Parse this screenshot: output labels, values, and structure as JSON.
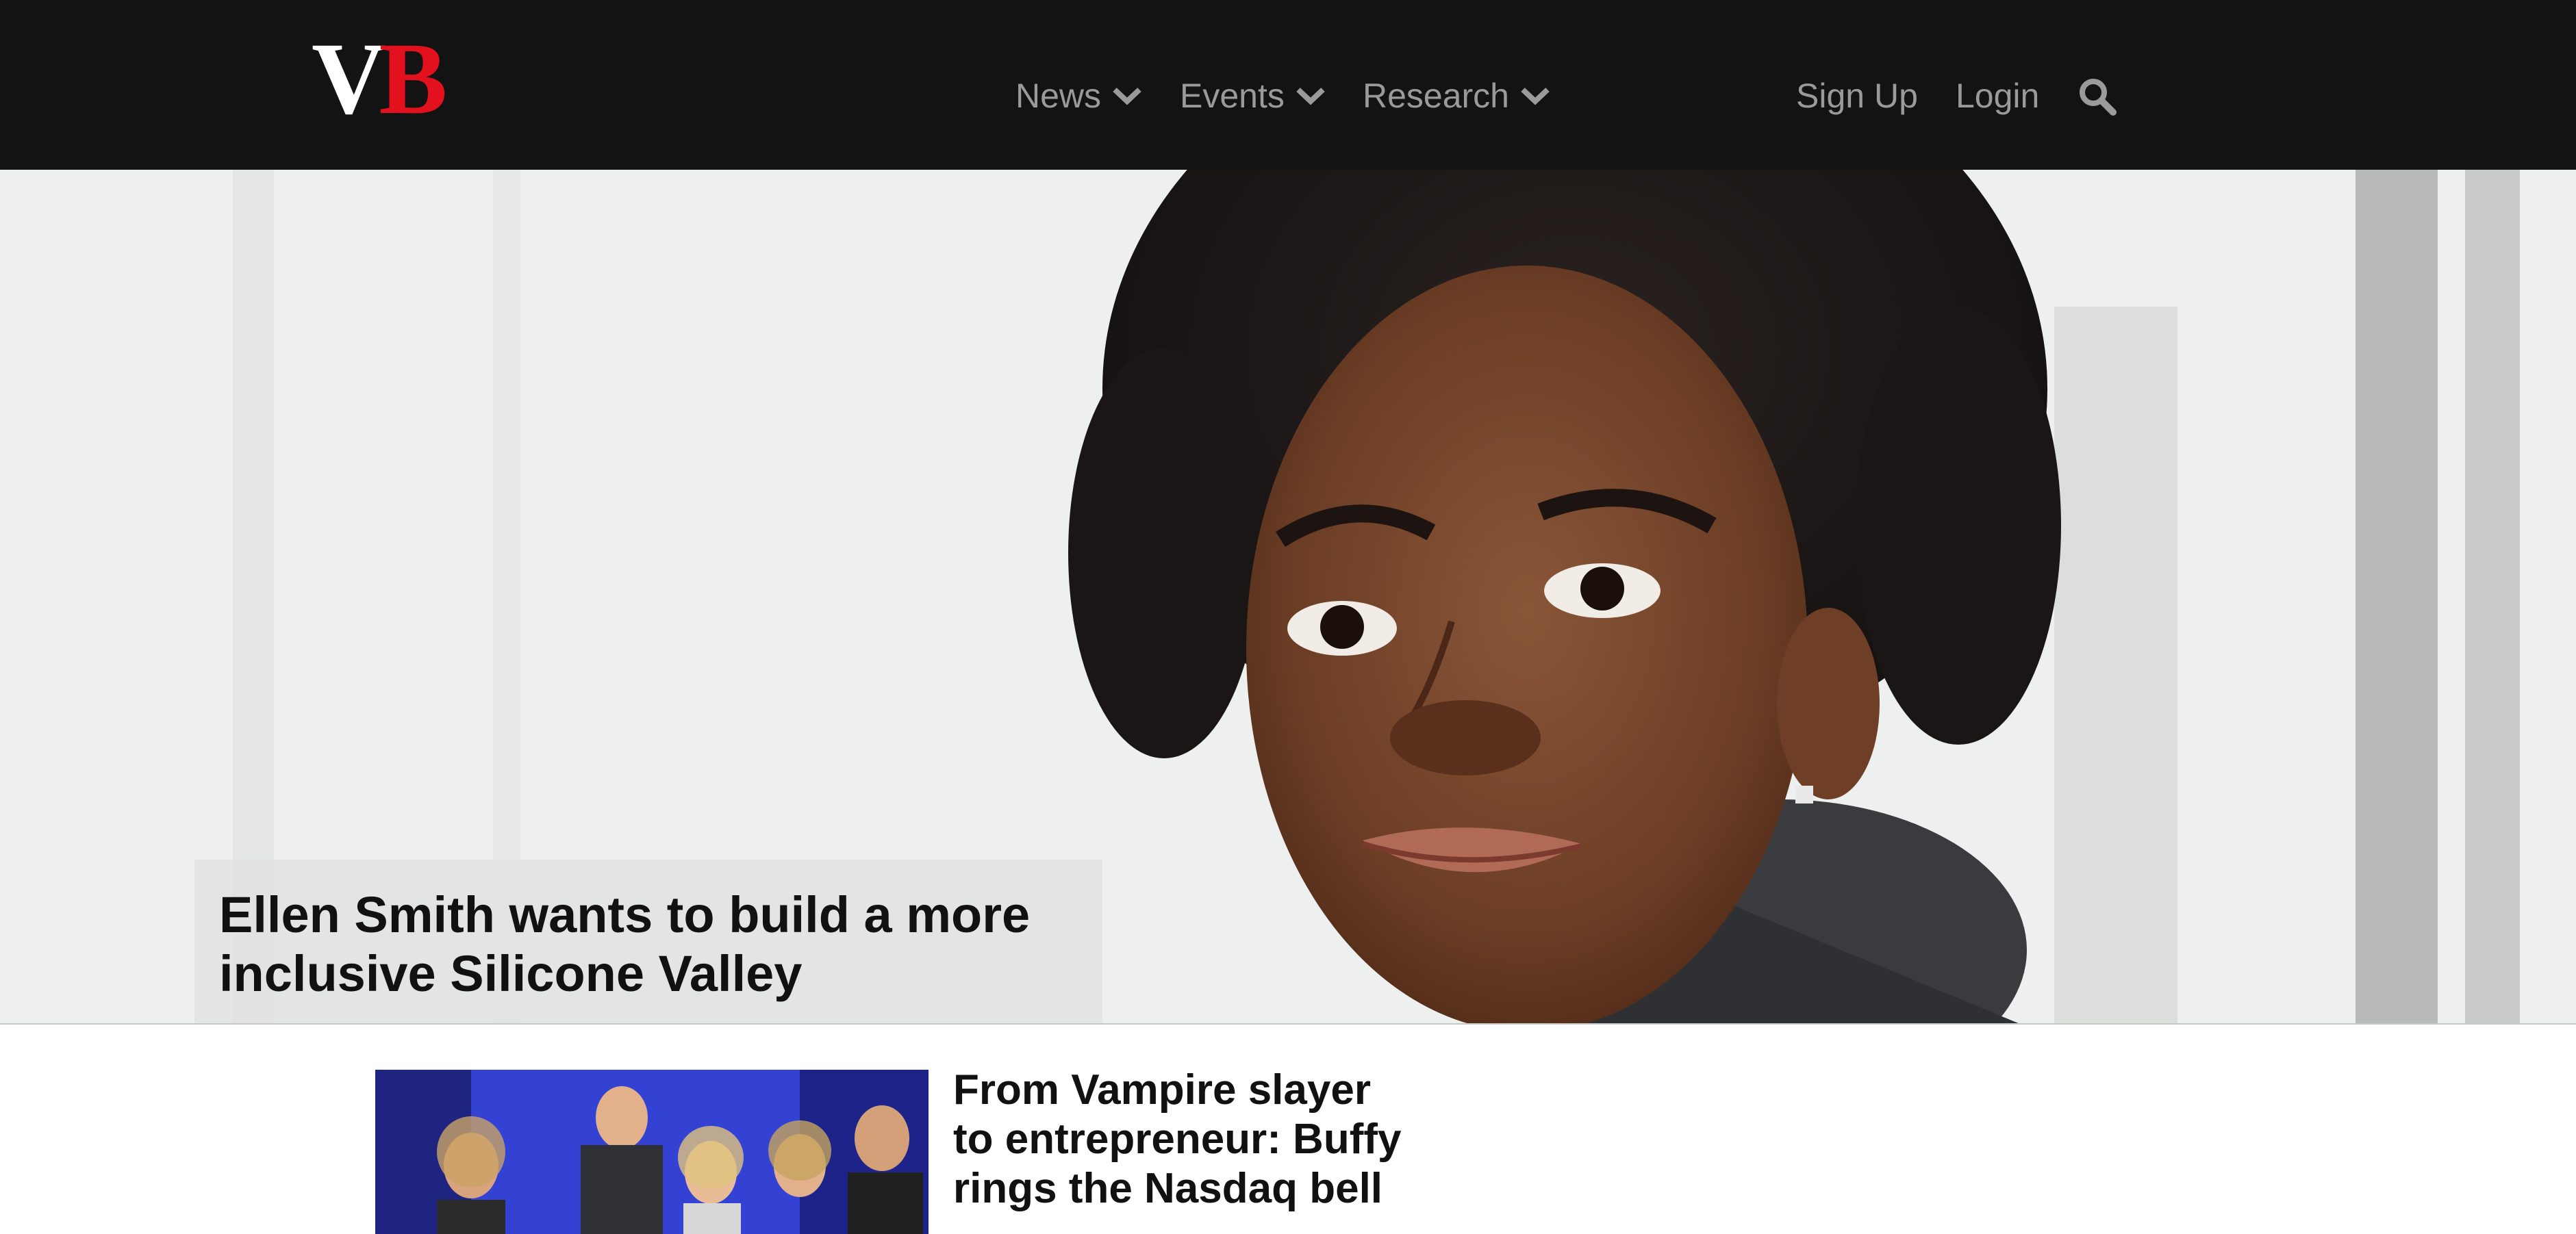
{
  "brand": {
    "logo_v": "V",
    "logo_b": "B",
    "accent": "#e3101d",
    "topbar_bg": "#131313"
  },
  "nav": {
    "items": [
      {
        "label": "News",
        "icon": "chevron-down-icon"
      },
      {
        "label": "Events",
        "icon": "chevron-down-icon"
      },
      {
        "label": "Research",
        "icon": "chevron-down-icon"
      }
    ],
    "signup": "Sign Up",
    "login": "Login",
    "search_icon": "search-icon"
  },
  "hero": {
    "headline_line1": "Ellen Smith wants to build a more",
    "headline_line2": "inclusive Silicone Valley"
  },
  "story": {
    "title_line1": "From Vampire slayer",
    "title_line2": "to entrepreneur: Buffy",
    "title_line3": "rings the Nasdaq bell"
  }
}
